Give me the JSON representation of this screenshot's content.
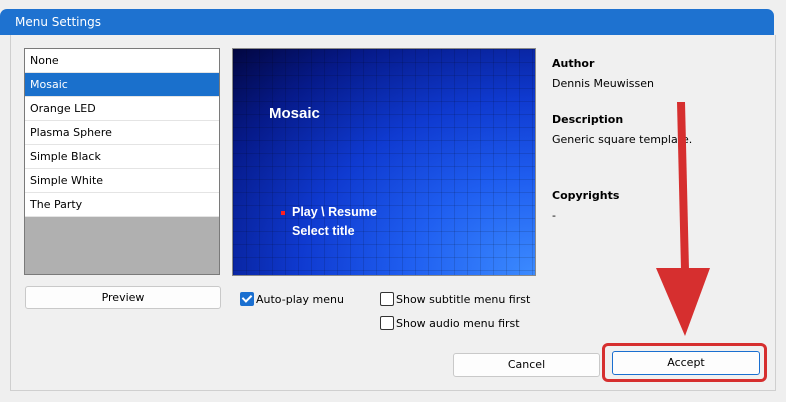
{
  "window": {
    "title": "Menu Settings"
  },
  "menu_list": {
    "items": [
      {
        "label": "None"
      },
      {
        "label": "Mosaic"
      },
      {
        "label": "Orange LED"
      },
      {
        "label": "Plasma Sphere"
      },
      {
        "label": "Simple Black"
      },
      {
        "label": "Simple White"
      },
      {
        "label": "The Party"
      }
    ],
    "selected": "Mosaic"
  },
  "preview_button": "Preview",
  "preview": {
    "title": "Mosaic",
    "menu_items": [
      "Play \\ Resume",
      "Select title"
    ]
  },
  "info": {
    "author_label": "Author",
    "author_value": "Dennis Meuwissen",
    "description_label": "Description",
    "description_value": "Generic square template.",
    "copyrights_label": "Copyrights",
    "copyrights_value": "-"
  },
  "options": {
    "autoplay": {
      "label": "Auto-play menu",
      "checked": true
    },
    "subtitle_first": {
      "label": "Show subtitle menu first",
      "checked": false
    },
    "audio_first": {
      "label": "Show audio menu first",
      "checked": false
    }
  },
  "buttons": {
    "cancel": "Cancel",
    "accept": "Accept"
  },
  "colors": {
    "titlebar": "#1e72d0",
    "selection": "#1a70cc",
    "annotation": "#d62f2f"
  }
}
